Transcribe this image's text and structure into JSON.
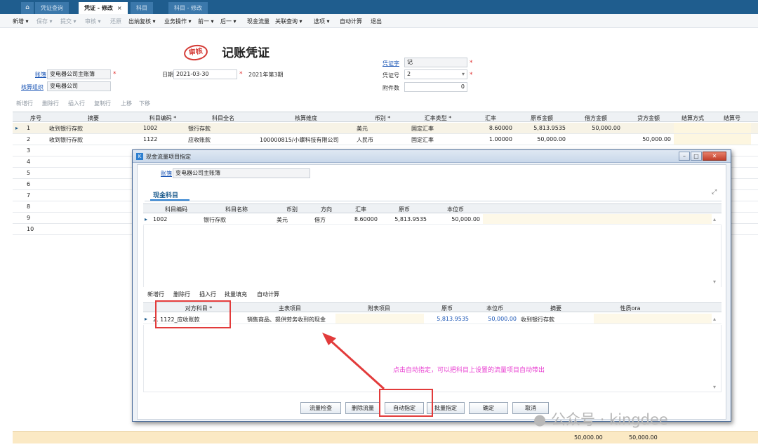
{
  "tabs": {
    "home_icon": "home-icon",
    "t1": "凭证查询",
    "t2": "凭证 - 修改",
    "t2_close": "×",
    "t3": "科目",
    "t4": "科目 - 修改"
  },
  "toolbar": {
    "new": "新增 ▾",
    "save": "保存 ▾",
    "submit": "提交 ▾",
    "audit": "审核 ▾",
    "restore": "还原",
    "cashier": "出纳复核 ▾",
    "biz": "业务操作 ▾",
    "prev": "前一 ▾",
    "next": "后一 ▾",
    "cashflow": "现金流量",
    "linkquery": "关联查询 ▾",
    "options": "选项 ▾",
    "autocalc": "自动计算",
    "exit": "退出"
  },
  "header": {
    "stamp": "审核",
    "title": "记账凭证",
    "book_label": "账簿",
    "book_value": "变电器公司主账簿",
    "org_label": "核算组织",
    "org_value": "变电器公司",
    "date_label": "日期",
    "date_value": "2021-03-30",
    "period": "2021年第3期",
    "vword_label": "凭证字",
    "vword_value": "记",
    "vno_label": "凭证号",
    "vno_value": "2",
    "attach_label": "附件数",
    "attach_value": "0",
    "req_mark": "*"
  },
  "entry_toolbar": {
    "add": "新增行",
    "del": "删除行",
    "ins": "插入行",
    "copy": "复制行",
    "up": "上移",
    "down": "下移"
  },
  "grid": {
    "columns": [
      "序号",
      "摘要",
      "科目编码 *",
      "科目全名",
      "核算维度",
      "币别 *",
      "汇率类型 *",
      "汇率",
      "原币金额",
      "借方金额",
      "贷方金额",
      "结算方式",
      "结算号"
    ],
    "rows": [
      {
        "no": "1",
        "summary": "收到银行存款",
        "code": "1002",
        "name": "银行存款",
        "dim": "",
        "cur": "美元",
        "rtype": "固定汇率",
        "rate": "8.60000",
        "orig": "5,813.9535",
        "debit": "50,000.00",
        "credit": ""
      },
      {
        "no": "2",
        "summary": "收到银行存款",
        "code": "1122",
        "name": "应收账款",
        "dim": "100000815/小蝶科技有限公司",
        "cur": "人民币",
        "rtype": "固定汇率",
        "rate": "1.00000",
        "orig": "50,000.00",
        "debit": "",
        "credit": "50,000.00"
      },
      {
        "no": "3"
      },
      {
        "no": "4"
      },
      {
        "no": "5"
      },
      {
        "no": "6"
      },
      {
        "no": "7"
      },
      {
        "no": "8"
      },
      {
        "no": "9"
      },
      {
        "no": "10"
      }
    ],
    "total_debit": "50,000.00",
    "total_credit": "50,000.00"
  },
  "dialog": {
    "title": "现金流量项目指定",
    "book_label": "账簿",
    "book_value": "变电器公司主账簿",
    "section": "现金科目",
    "top_columns": [
      "科目编码",
      "科目名称",
      "币别",
      "方向",
      "汇率",
      "原币",
      "本位币"
    ],
    "top_row": {
      "code": "1002",
      "name": "银行存款",
      "cur": "美元",
      "dir": "借方",
      "rate": "8.60000",
      "orig": "5,813.9535",
      "base": "50,000.00"
    },
    "bottom_toolbar": {
      "add": "新增行",
      "del": "删除行",
      "ins": "插入行",
      "fill": "批量填充",
      "auto": "自动计算"
    },
    "bottom_columns": [
      "对方科目 *",
      "主表项目",
      "附表项目",
      "原币",
      "本位币",
      "摘要",
      "性质ora"
    ],
    "bottom_row": {
      "acct": "2. 1122_应收账款",
      "main": "销售商品、提供劳务收到的现金",
      "sub": "",
      "orig": "5,813.9535",
      "base": "50,000.00",
      "summary": "收到银行存款"
    },
    "buttons": {
      "check": "流量检查",
      "delete": "删除流量",
      "auto": "自动指定",
      "batch": "批量指定",
      "ok": "确定",
      "cancel": "取消"
    }
  },
  "annotation": "点击自动指定，可以把科目上设置的流量项目自动带出",
  "watermark": "公众号 · kingdee",
  "colors": {
    "accent": "#1f5d8e",
    "highlight": "#e23b3b",
    "annotation": "#e83cd0"
  }
}
